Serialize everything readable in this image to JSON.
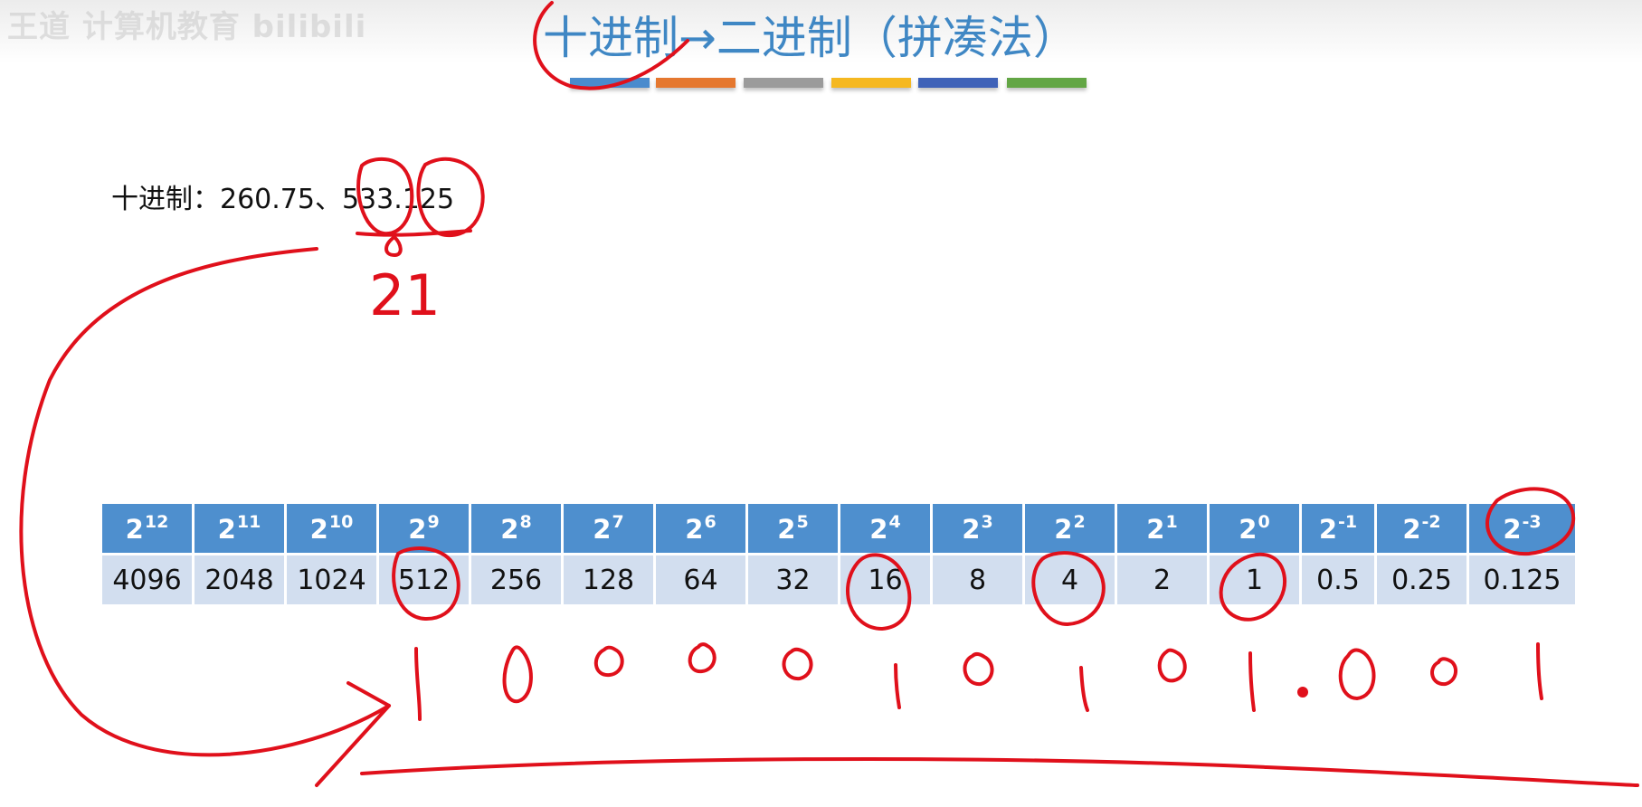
{
  "header": {
    "watermark": "王道 计算机教育 bilibili",
    "title": "十进制→二进制（拼凑法）",
    "color_bars": [
      "#4a8bcd",
      "#e5782f",
      "#9b9b9b",
      "#f5b820",
      "#3f62b8",
      "#63a645"
    ]
  },
  "decimal": {
    "text": "十进制：260.75、533.125"
  },
  "powers_table": {
    "exponents": [
      "12",
      "11",
      "10",
      "9",
      "8",
      "7",
      "6",
      "5",
      "4",
      "3",
      "2",
      "1",
      "0",
      "-1",
      "-2",
      "-3"
    ],
    "values": [
      "4096",
      "2048",
      "1024",
      "512",
      "256",
      "128",
      "64",
      "32",
      "16",
      "8",
      "4",
      "2",
      "1",
      "0.5",
      "0.25",
      "0.125"
    ],
    "header_color": "#4e8fce",
    "value_color": "#d2deef"
  },
  "annotations": {
    "ink_color": "#e0101b",
    "remainder": "21",
    "binary_digits": [
      "1",
      "0",
      "0",
      "0",
      "0",
      "1",
      "0",
      "1",
      "0",
      "1",
      "0",
      "0",
      "1"
    ],
    "binary_point": "."
  }
}
